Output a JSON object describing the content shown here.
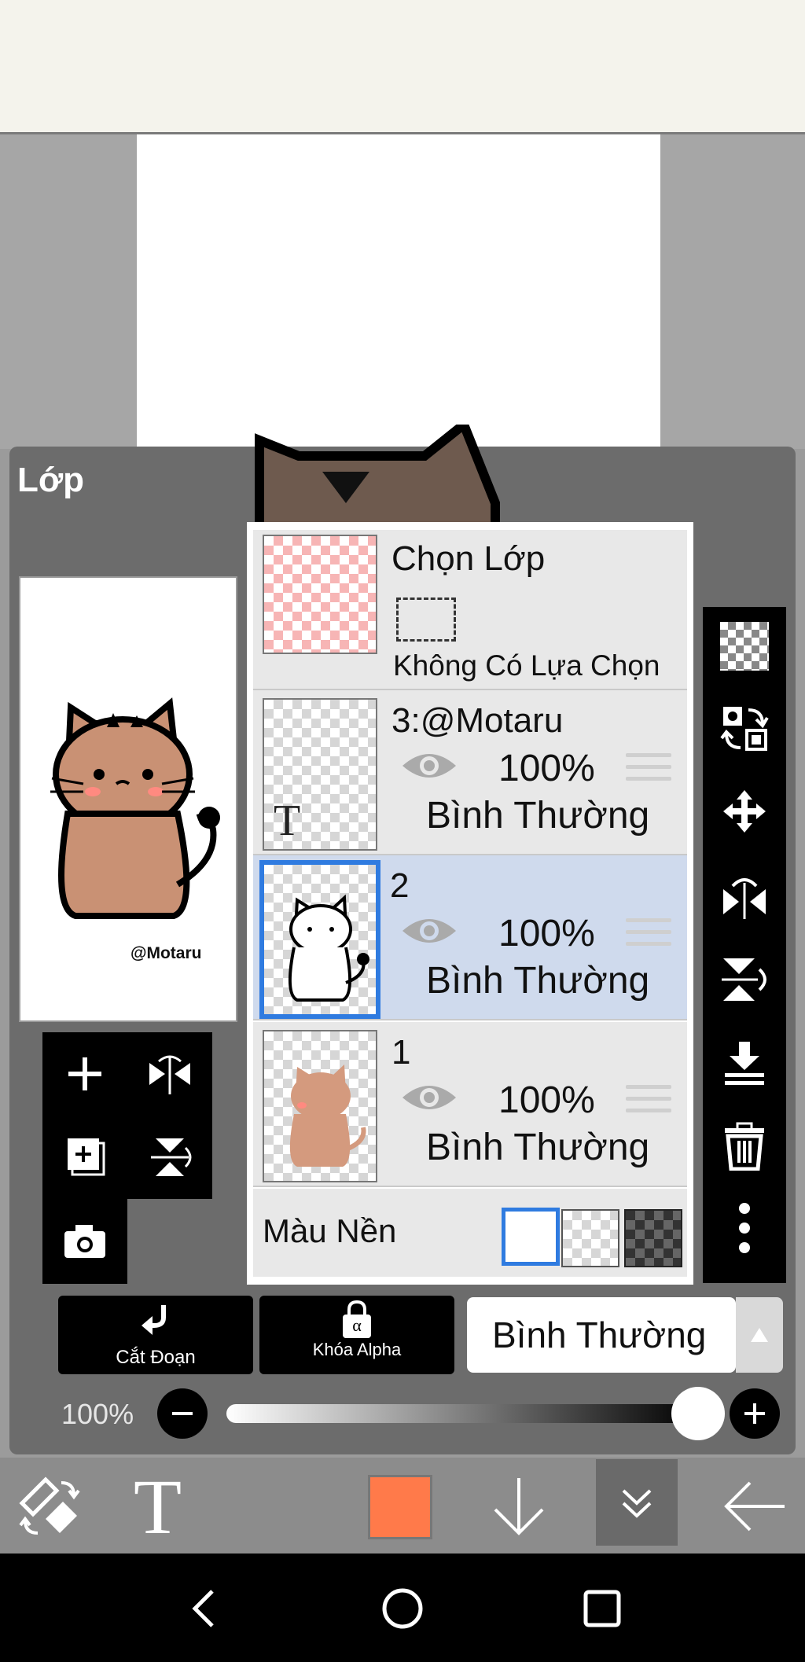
{
  "panel": {
    "title": "Lớp"
  },
  "watermark": "@Motaru",
  "selection_layer": {
    "title": "Chọn Lớp",
    "status": "Không Có Lựa Chọn"
  },
  "layers": [
    {
      "name": "3:@Motaru",
      "opacity": "100%",
      "blend": "Bình Thường",
      "type_badge": "T"
    },
    {
      "name": "2",
      "opacity": "100%",
      "blend": "Bình Thường",
      "selected": true
    },
    {
      "name": "1",
      "opacity": "100%",
      "blend": "Bình Thường"
    }
  ],
  "background": {
    "label": "Màu Nền"
  },
  "bottom_buttons": {
    "clip": "Cắt Đoạn",
    "alpha_lock": "Khóa Alpha",
    "alpha_symbol": "α"
  },
  "blend_mode": {
    "value": "Bình Thường"
  },
  "opacity_slider": {
    "label": "100%",
    "value": 1.0
  },
  "colors": {
    "current_color": "#ff7a4a",
    "selected_row": "#cfdaed",
    "accent": "#2f7be0"
  },
  "icons": [
    "add-layer-icon",
    "flip-horizontal-icon",
    "add-copy-layer-icon",
    "flip-vertical-icon",
    "camera-icon",
    "transparency-icon",
    "swap-icon",
    "move-icon",
    "flip-h-icon",
    "flip-v-icon",
    "merge-down-icon",
    "trash-icon",
    "more-icon",
    "eraser-swap-icon",
    "text-tool-icon",
    "arrow-down-icon",
    "collapse-icon",
    "back-arrow-icon",
    "nav-back-icon",
    "nav-home-icon",
    "nav-recents-icon"
  ]
}
